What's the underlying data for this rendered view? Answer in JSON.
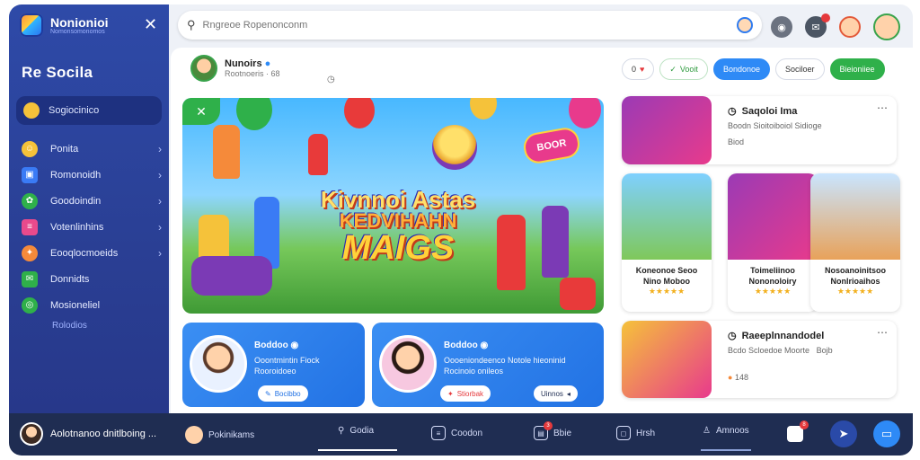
{
  "app": {
    "name": "Nonionioi",
    "tagline": "Nomonsomonomos"
  },
  "sidebar": {
    "title": "Re  Socila",
    "active_item": {
      "label": "Sogiocinico",
      "icon": "home-icon"
    },
    "items": [
      {
        "label": "Ponita",
        "icon": "smiley-icon",
        "color": "#f5c23a"
      },
      {
        "label": "Romonoidh",
        "icon": "photo-icon",
        "color": "#3a7bf5"
      },
      {
        "label": "Goodoindin",
        "icon": "leaf-icon",
        "color": "#2fb04a"
      },
      {
        "label": "Votenlinhins",
        "icon": "list-icon",
        "color": "#e84a8c"
      },
      {
        "label": "Eooqlocmoeids",
        "icon": "gift-icon",
        "color": "#f58a3a"
      },
      {
        "label": "Donnidts",
        "icon": "chat-icon",
        "color": "#2fb04a"
      },
      {
        "label": "Mosioneliel",
        "icon": "globe-icon",
        "color": "#2fb04a"
      }
    ],
    "plain_item": "Rolodios"
  },
  "search": {
    "placeholder": "Rngreoe Ropenonconm"
  },
  "profile": {
    "name": "Nunoirs",
    "sub": "Rootnoeris  ·  68"
  },
  "actions": {
    "counter": "0",
    "follow": "Vooit",
    "primary": "Bondonoe",
    "secondary": "Sociloer",
    "cta": "Bieioniiee"
  },
  "hero": {
    "line1": "Kivnnoi Astas",
    "line2": "KEDVIHAHN",
    "line3": "MAIGS",
    "sign": "BOOR"
  },
  "cards": [
    {
      "title": "Boddoo",
      "desc_lines": [
        "Ooontmintin Fiock",
        "Rooroidoeo"
      ],
      "button": "Bocibbo"
    },
    {
      "title": "Boddoo",
      "desc_lines": [
        "Oooeniondeenco Notole hieoninid",
        "Rocinoio onileos"
      ],
      "button": "Stiorbak",
      "button2": "Uinnos"
    }
  ],
  "right_top": {
    "title": "Saqoloi Ima",
    "sub": "Boodn  Sioitoiboiol Sidioge",
    "meta": "Biod"
  },
  "tiles": [
    {
      "title_lines": [
        "Koneonoe Seoo",
        "Nino Moboo"
      ],
      "rating": "★★★★★"
    },
    {
      "title_lines": [
        "Toimeliinoo",
        "Nononoloiry"
      ],
      "rating": "★★★★★"
    },
    {
      "title_lines": [
        "Nosoanoinitsoo",
        "Nonlrioaihos"
      ],
      "rating": "★★★★★"
    }
  ],
  "right_bottom": {
    "title": "Raeeplnnandodel",
    "sub": "Bcdo  Scloedoe Moorte",
    "sub2": "Bojb",
    "meta": "148"
  },
  "bottom_nav": {
    "user": "Aolotnanoo dnitlboing ...",
    "items": [
      {
        "label": "Pokinikams",
        "icon": "avatar-icon"
      },
      {
        "label": "Godia",
        "icon": "search-icon"
      },
      {
        "label": "Coodon",
        "icon": "message-icon"
      },
      {
        "label": "Bbie",
        "icon": "bookmark-icon",
        "badge": "3"
      },
      {
        "label": "Hrsh",
        "icon": "chat-icon"
      },
      {
        "label": "Amnoos",
        "icon": "profile-icon"
      }
    ],
    "badge_right": "8"
  },
  "colors": {
    "sidebar": "#2e4aa8",
    "accent_blue": "#2e8af6",
    "accent_green": "#2fb04a",
    "nav": "#1f2d52"
  }
}
